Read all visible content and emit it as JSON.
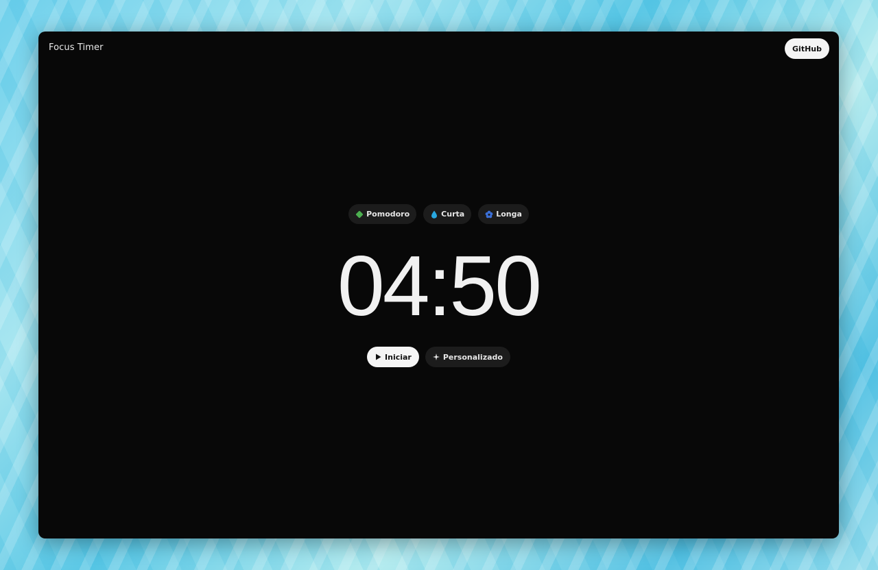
{
  "app": {
    "title": "Focus Timer",
    "github_label": "GitHub"
  },
  "modes": [
    {
      "label": "Pomodoro",
      "icon": "clover-icon",
      "color": "#4caf50"
    },
    {
      "label": "Curta",
      "icon": "droplet-icon",
      "color": "#29a8e0"
    },
    {
      "label": "Longa",
      "icon": "flower-icon",
      "color": "#3b6fd6"
    }
  ],
  "timer": {
    "display": "04:50"
  },
  "controls": {
    "start_label": "Iniciar",
    "start_icon": "play-icon",
    "custom_label": "Personalizado",
    "custom_icon": "sparkle-icon"
  },
  "colors": {
    "window_bg": "#080808",
    "chip_bg": "#1c1c1c",
    "light_button_bg": "#f5f5f5"
  }
}
